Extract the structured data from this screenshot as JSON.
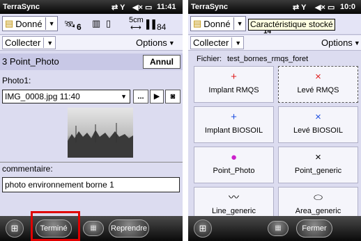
{
  "left": {
    "app_title": "TerraSync",
    "time": "11:41",
    "data_menu": "Donné",
    "satellites": "6",
    "precision_value": "5cm",
    "precision_extra": "84",
    "collect_menu": "Collecter",
    "options_menu": "Options",
    "feature_title": "3 Point_Photo",
    "cancel_label": "Annul",
    "photo_label": "Photo1:",
    "photo_value": "IMG_0008.jpg 11:40",
    "browse_label": "...",
    "comment_label": "commentaire:",
    "comment_value": "photo  environnement borne 1",
    "done_label": "Terminé",
    "resume_label": "Reprendre"
  },
  "right": {
    "app_title": "TerraSync",
    "time": "10:0",
    "data_menu": "Donné",
    "tooltip": "Caractéristique stocké",
    "satellites": "14",
    "collect_menu": "Collecter",
    "options_menu": "Options",
    "file_label": "Fichier:",
    "file_value": "test_bornes_rmqs_foret",
    "close_label": "Fermer",
    "tiles": [
      {
        "label": "Implant RMQS",
        "icon": "plus-icon",
        "color": "#e02020"
      },
      {
        "label": "Levé RMQS",
        "icon": "x-icon",
        "color": "#e02020"
      },
      {
        "label": "Implant BIOSOIL",
        "icon": "plus-icon",
        "color": "#2050e0"
      },
      {
        "label": "Levé BIOSOIL",
        "icon": "x-icon",
        "color": "#2050e0"
      },
      {
        "label": "Point_Photo",
        "icon": "info-icon",
        "color": "#cc20cc"
      },
      {
        "label": "Point_generic",
        "icon": "x-icon",
        "color": "#000000"
      },
      {
        "label": "Line_generic",
        "icon": "line-icon",
        "color": "#000000"
      },
      {
        "label": "Area_generic",
        "icon": "area-icon",
        "color": "#000000"
      }
    ]
  },
  "colors": {
    "highlight": "#e00000",
    "selection": "#c8c8e6"
  }
}
